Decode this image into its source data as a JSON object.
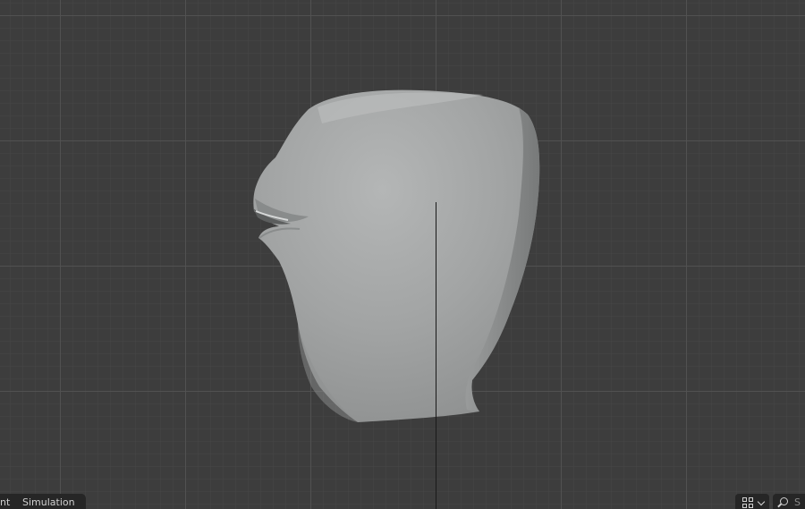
{
  "viewport": {
    "background_color": "#3d3d3d",
    "mesh_color": "#a3a5a5"
  },
  "tabs": {
    "partial_tab_label": "nt",
    "simulation_tab_label": "Simulation"
  },
  "header_right": {
    "editor_type_icon": "grid-icon",
    "search_icon": "search-icon",
    "search_placeholder": "S"
  }
}
